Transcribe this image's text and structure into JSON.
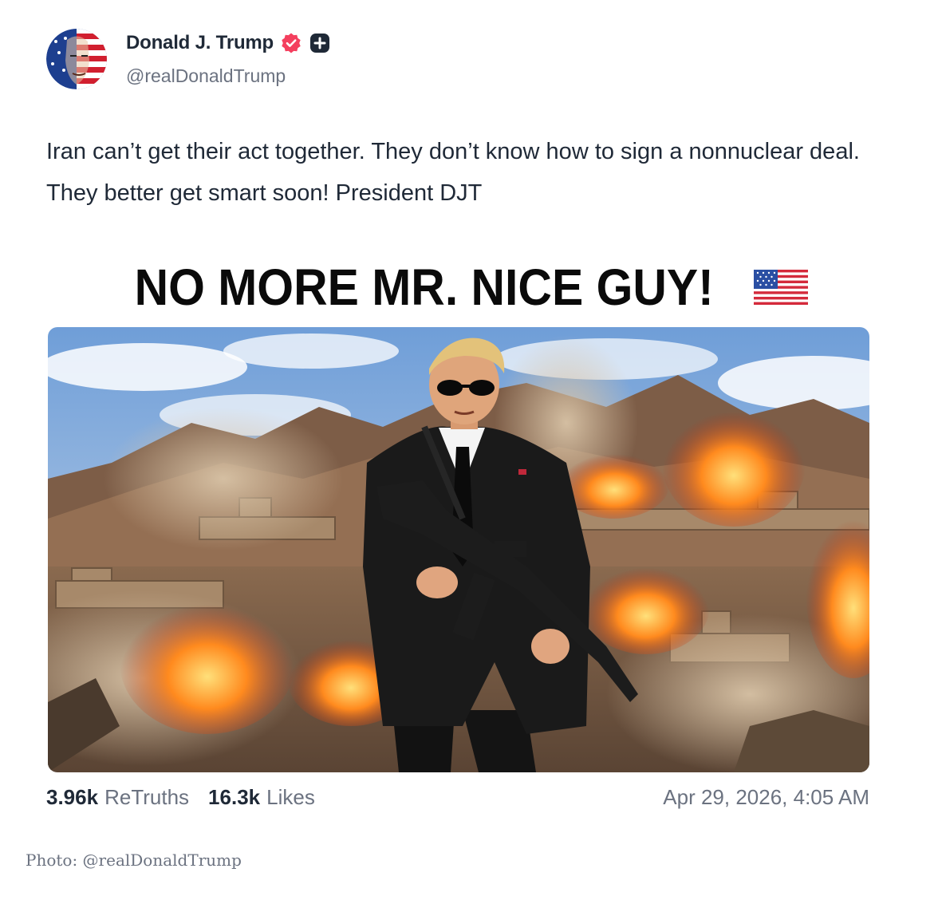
{
  "post": {
    "author": {
      "display_name": "Donald J. Trump",
      "handle": "@realDonaldTrump",
      "verified_icon": "verified-badge-icon",
      "badge_icon": "plus-badge-icon"
    },
    "text": "Iran can’t get their act together. They don’t know how to sign a nonnuclear deal. They better get smart soon! President DJT",
    "image": {
      "caption": "NO MORE MR. NICE GUY!",
      "caption_emoji": "us-flag-icon",
      "scene": "man in black suit and sunglasses holding rifle in front of desert mountains with explosions"
    },
    "stats": {
      "retruths_count": "3.96k",
      "retruths_label": "ReTruths",
      "likes_count": "16.3k",
      "likes_label": "Likes"
    },
    "timestamp": "Apr 29, 2026, 4:05 AM"
  },
  "credit": "Photo: @realDonaldTrump",
  "colors": {
    "verified": "#f43f5e",
    "text": "#1f2937",
    "muted": "#6b7280"
  }
}
